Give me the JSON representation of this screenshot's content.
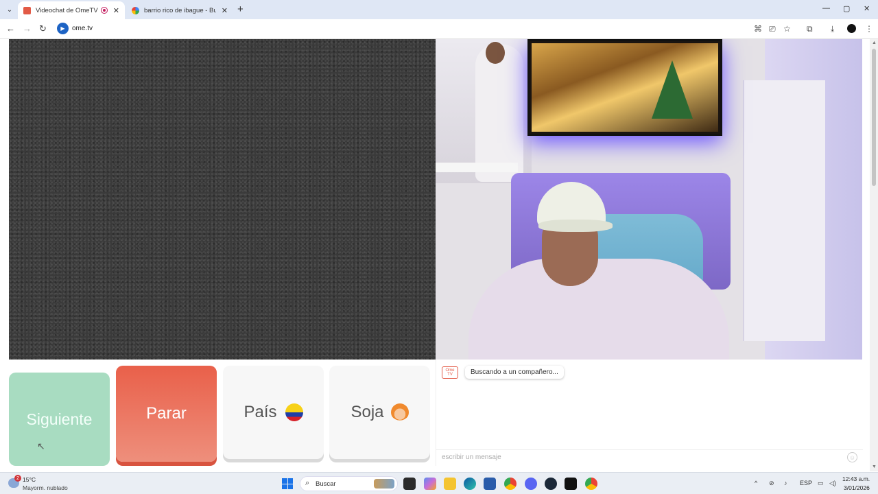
{
  "browser": {
    "tabs": [
      {
        "title": "Videochat de OmeTV: una",
        "active": true
      },
      {
        "title": "barrio rico de ibague - Buscar c",
        "active": false
      }
    ],
    "new_tab": "+",
    "url": "ome.tv",
    "window_controls": {
      "minimize": "—",
      "maximize": "▢",
      "close": "✕"
    }
  },
  "controls": {
    "next_label": "Siguiente",
    "stop_label": "Parar",
    "country_label": "País",
    "gender_label": "Soja"
  },
  "chat": {
    "logo_text": "Ome TV",
    "status_message": "Buscando a un compañero...",
    "input_placeholder": "escribir un mensaje"
  },
  "taskbar": {
    "weather_temp": "15°C",
    "weather_desc": "Mayorm. nublado",
    "weather_badge": "2",
    "search_label": "Buscar",
    "language": "ESP",
    "time": "12:43 a.m.",
    "date": "3/01/2026"
  },
  "colors": {
    "next": "#a8dcc1",
    "stop": "#e9604a",
    "neutral_button": "#f7f7f7",
    "brand": "#e25a46"
  }
}
